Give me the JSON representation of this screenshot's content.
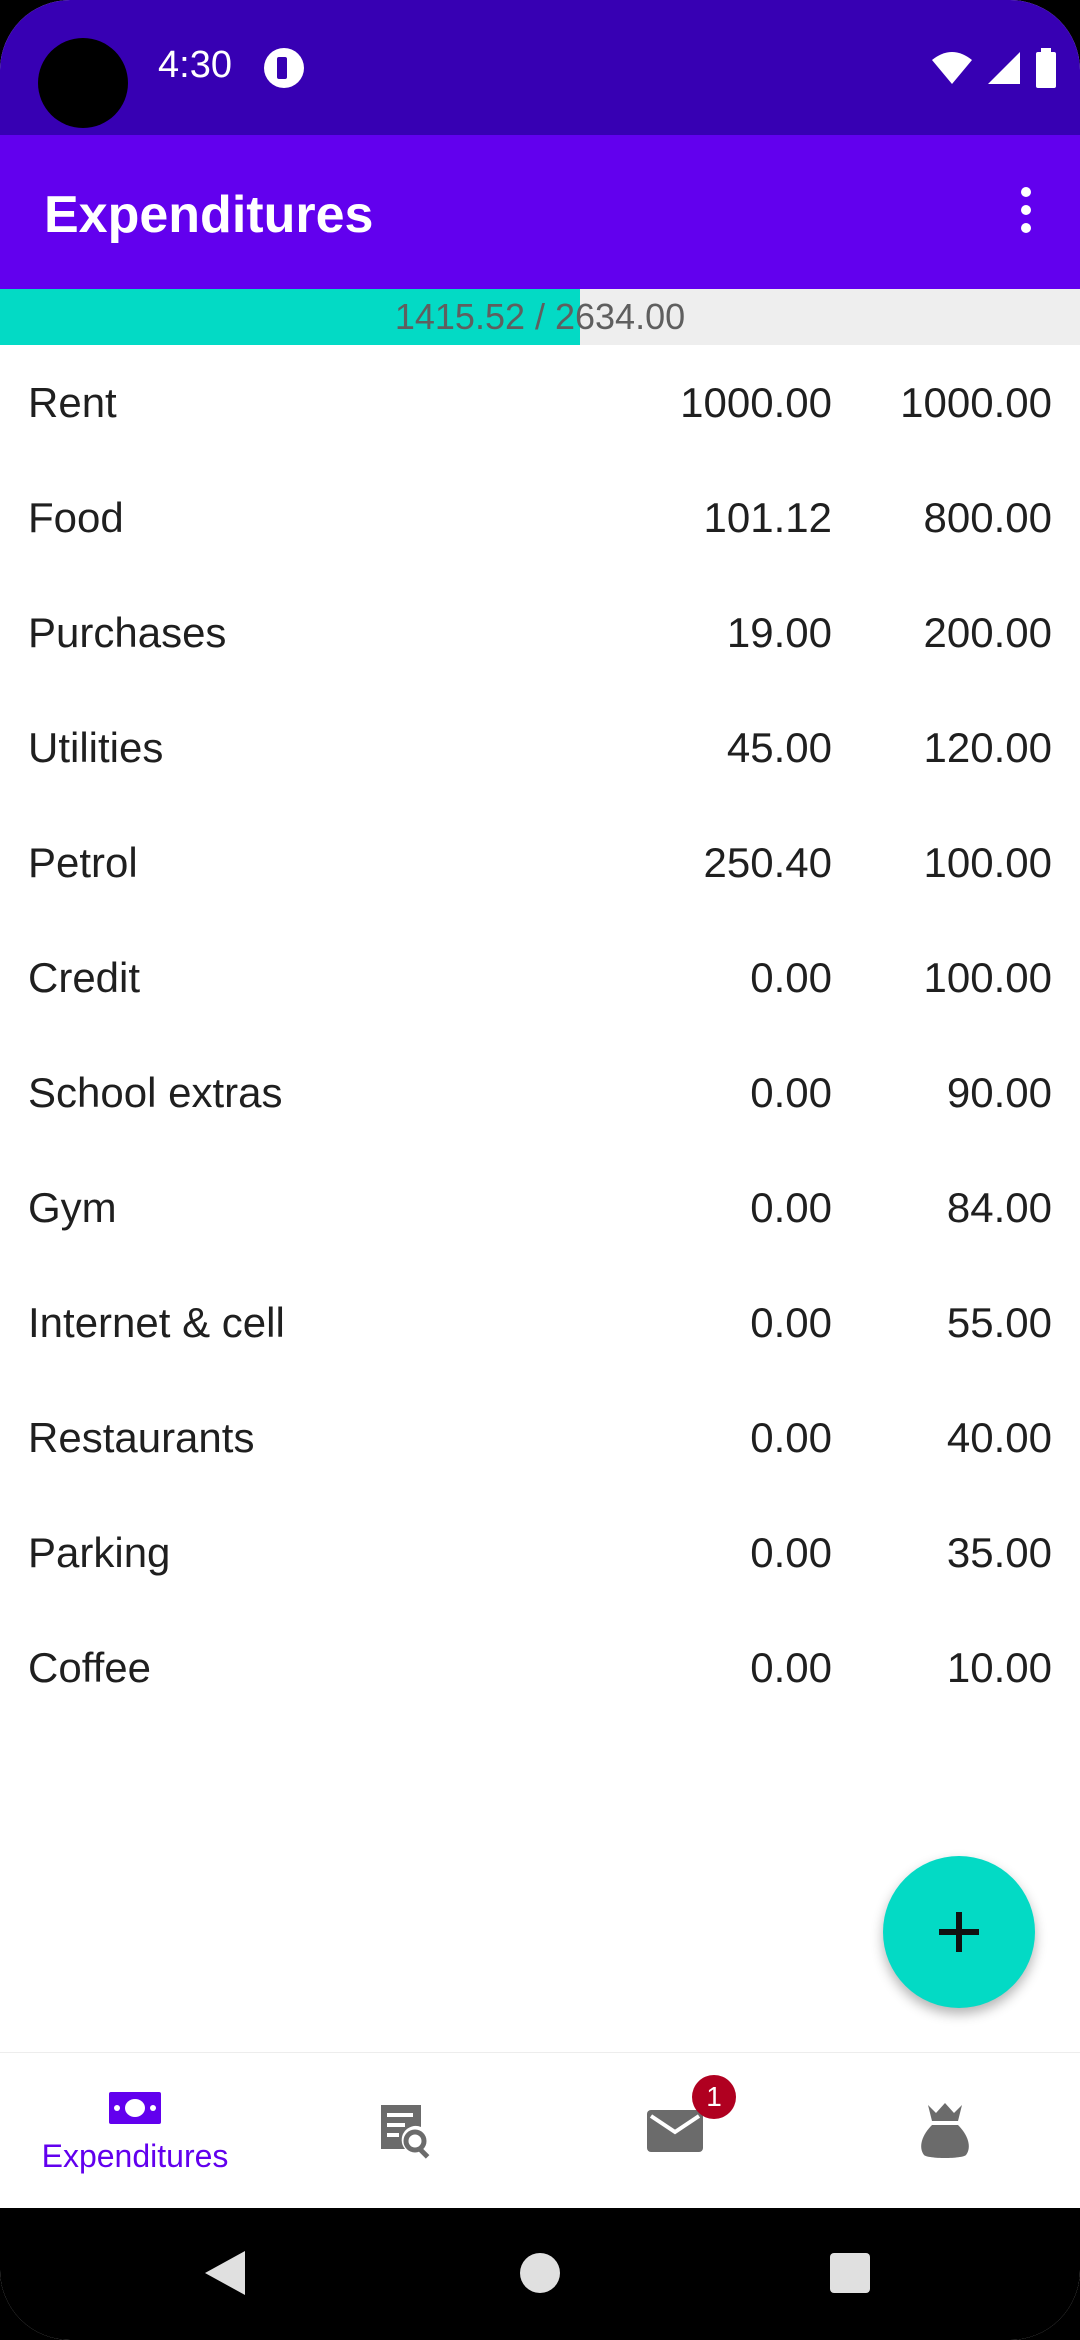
{
  "status_bar": {
    "time": "4:30",
    "icons": [
      "camera-cutout",
      "app-notification-icon",
      "wifi-icon",
      "signal-icon",
      "battery-icon"
    ]
  },
  "app_bar": {
    "title": "Expenditures",
    "menu_icon": "more-vert-icon"
  },
  "budget_bar": {
    "spent": "1415.52",
    "total": "2634.00",
    "text": "1415.52 / 2634.00",
    "fill_fraction": 0.5374,
    "fill_color": "#03dac5",
    "track_color": "#eeeeee"
  },
  "categories": [
    {
      "name": "Rent",
      "spent": "1000.00",
      "budget": "1000.00"
    },
    {
      "name": "Food",
      "spent": "101.12",
      "budget": "800.00"
    },
    {
      "name": "Purchases",
      "spent": "19.00",
      "budget": "200.00"
    },
    {
      "name": "Utilities",
      "spent": "45.00",
      "budget": "120.00"
    },
    {
      "name": "Petrol",
      "spent": "250.40",
      "budget": "100.00"
    },
    {
      "name": "Credit",
      "spent": "0.00",
      "budget": "100.00"
    },
    {
      "name": "School extras",
      "spent": "0.00",
      "budget": "90.00"
    },
    {
      "name": "Gym",
      "spent": "0.00",
      "budget": "84.00"
    },
    {
      "name": "Internet & cell",
      "spent": "0.00",
      "budget": "55.00"
    },
    {
      "name": "Restaurants",
      "spent": "0.00",
      "budget": "40.00"
    },
    {
      "name": "Parking",
      "spent": "0.00",
      "budget": "35.00"
    },
    {
      "name": "Coffee",
      "spent": "0.00",
      "budget": "10.00"
    }
  ],
  "fab": {
    "icon": "plus-icon"
  },
  "bottom_nav": {
    "items": [
      {
        "icon": "money-icon",
        "label": "Expenditures",
        "active": true
      },
      {
        "icon": "receipt-search-icon",
        "label": ""
      },
      {
        "icon": "mail-icon",
        "label": "",
        "badge": "1"
      },
      {
        "icon": "money-bag-icon",
        "label": ""
      }
    ]
  },
  "colors": {
    "status_bar": "#3700b3",
    "app_bar": "#6200ee",
    "accent": "#03dac5",
    "nav_active": "#6200ee",
    "nav_inactive": "#6b6b6b",
    "badge": "#b00020"
  }
}
